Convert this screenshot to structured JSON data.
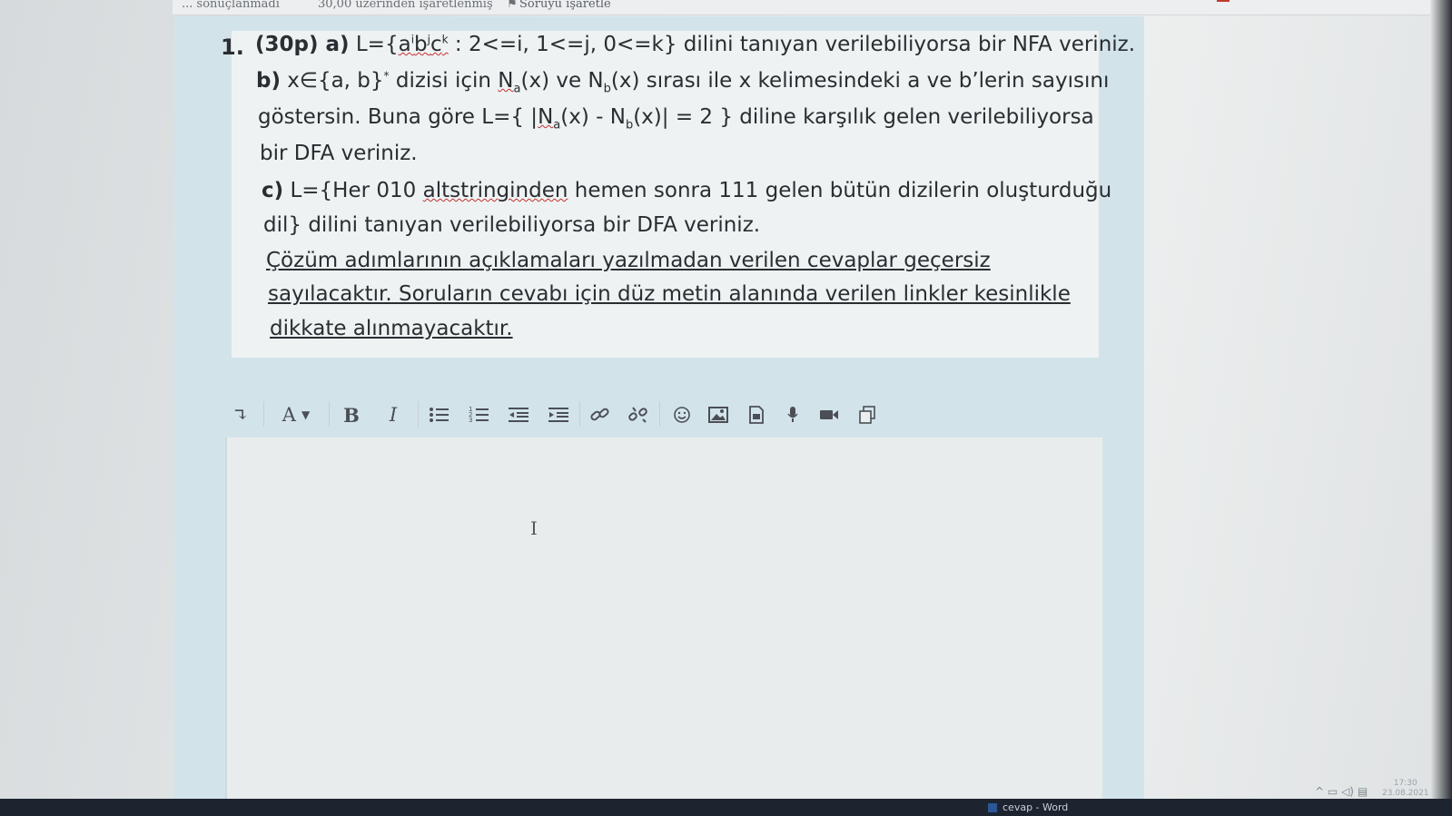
{
  "topbar": {
    "left_cut": "... sonuçlanmadı",
    "marked": "30,00 üzerinden işaretlenmiş",
    "flag_label": "Soruyu işaretle"
  },
  "question": {
    "number": "1.",
    "points": "(30p) a)",
    "a_lang_prefix": "L={",
    "a_lang_set": "a",
    "a_sup_i": "i",
    "a_b": "b",
    "a_sup_j": "j",
    "a_c": "c",
    "a_sup_k": "k",
    "a_cond": " : 2<=i, 1<=j, 0<=k}",
    "a_rest": " dilini tanıyan verilebiliyorsa bir NFA veriniz.",
    "b_label": "b)",
    "b_text_1": " x∈{a, b}",
    "b_star": "*",
    "b_text_2": " dizisi için ",
    "b_Na": "N",
    "b_sub_a": "a",
    "b_text_3": "(x) ve N",
    "b_sub_b": "b",
    "b_text_4": "(x) sırası ile x kelimesindeki a ve b’lerin sayısını",
    "b_line2_1": "göstersin. Buna göre L={  |",
    "b_line2_N": "N",
    "b_line2_sa": "a",
    "b_line2_2": "(x) - N",
    "b_line2_sb": "b",
    "b_line2_3": "(x)| = 2 }  diline karşılık gelen verilebiliyorsa",
    "b_line3": "bir DFA veriniz.",
    "c_label": "c)",
    "c_text_1": " L={Her 010 ",
    "c_word": "altstringinden",
    "c_text_2": " hemen sonra 111 gelen bütün dizilerin oluşturduğu",
    "c_line2": "dil} dilini tanıyan verilebiliyorsa bir DFA veriniz.",
    "note_1": "Çözüm   adımlarının   açıklamaları   yazılmadan   verilen   cevaplar   geçersiz",
    "note_2": "sayılacaktır. Soruların cevabı için düz metin alanında verilen linkler kesinlikle",
    "note_3": "dikkate alınmayacaktır."
  },
  "toolbar": {
    "expand_glyph": "↴",
    "font_glyph": "A",
    "bold_glyph": "B",
    "italic_glyph": "I"
  },
  "editor": {
    "value": ""
  },
  "taskbar": {
    "word_title": "cevap - Word",
    "time": "17:30",
    "date": "23.08.2021"
  }
}
